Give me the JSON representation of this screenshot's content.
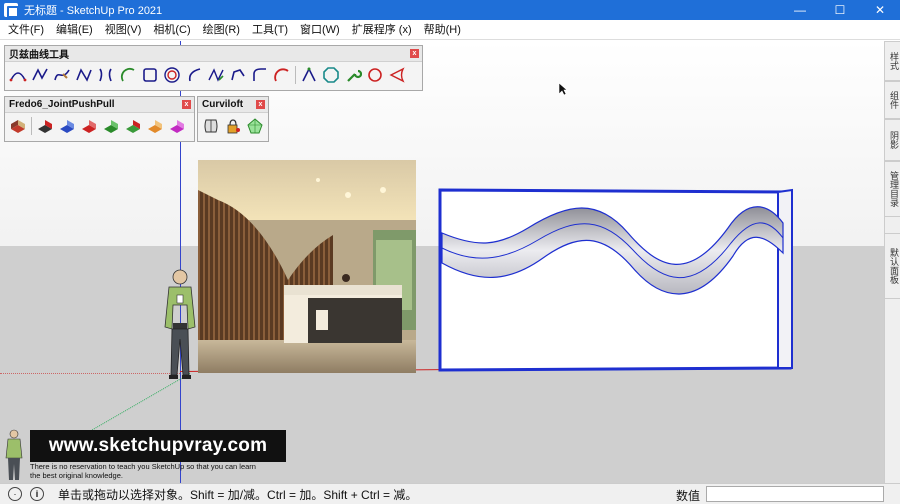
{
  "window": {
    "title": "无标题 - SketchUp Pro 2021",
    "minimize_glyph": "—",
    "maximize_glyph": "☐",
    "close_glyph": "✕"
  },
  "menu": [
    {
      "label": "文件(F)"
    },
    {
      "label": "编辑(E)"
    },
    {
      "label": "视图(V)"
    },
    {
      "label": "相机(C)"
    },
    {
      "label": "绘图(R)"
    },
    {
      "label": "工具(T)"
    },
    {
      "label": "窗口(W)"
    },
    {
      "label": "扩展程序 (x)"
    },
    {
      "label": "帮助(H)"
    }
  ],
  "toolbars": {
    "bezier": {
      "title": "贝兹曲线工具",
      "tool_count": 17
    },
    "fredo": {
      "title": "Fredo6_JointPushPull",
      "tool_count": 8
    },
    "curviloft": {
      "title": "Curviloft",
      "tool_count": 3
    }
  },
  "right_panel": {
    "tabs": [
      {
        "label": "样式"
      },
      {
        "label": "组件"
      },
      {
        "label": "阴影"
      },
      {
        "label": "管理目录"
      },
      {
        "label": "默认面板"
      }
    ]
  },
  "watermark": {
    "url": "www.sketchupvray.com",
    "line1": "There is no reservation to teach you SketchUp so that you can learn",
    "line2": "the best original knowledge."
  },
  "status": {
    "hint": "单击或拖动以选择对象。Shift = 加/减。Ctrl = 加。Shift + Ctrl = 减。",
    "measure_label": "数值",
    "measure_value": ""
  },
  "colors": {
    "title_bar": "#1f6fd8",
    "selection_blue": "#1e2fd0",
    "axis_red": "#cc2222"
  }
}
